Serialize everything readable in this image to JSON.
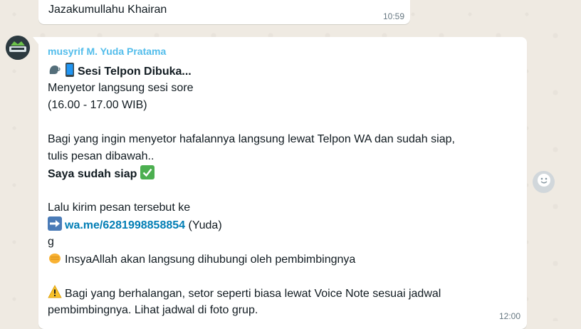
{
  "prev_message": {
    "text": "Jazakumullahu Khairan",
    "time": "10:59"
  },
  "message": {
    "sender": "musyrif M. Yuda Pratama",
    "title": "Sesi Telpon Dibuka...",
    "line1": "Menyetor langsung sesi sore",
    "line2": "(16.00 - 17.00 WIB)",
    "line3": "Bagi yang ingin menyetor hafalannya langsung lewat Telpon WA dan sudah siap,",
    "line4": "tulis pesan dibawah..",
    "ready": "Saya sudah siap",
    "line5": "Lalu kirim pesan tersebut ke",
    "link": "wa.me/6281998858854",
    "link_suffix": "(Yuda)",
    "line6": "g",
    "line7": "InsyaAllah akan langsung dihubungi oleh pembimbingnya",
    "line8": "Bagi yang berhalangan, setor seperti biasa lewat Voice Note sesuai jadwal",
    "line9": "pembimbingnya. Lihat jadwal di foto grup.",
    "time": "12:00"
  },
  "colors": {
    "sender": "#53bdeb",
    "link": "#027eb5",
    "check": "#4caf50"
  },
  "icons": [
    "speaking-head-icon",
    "mobile-phone-icon",
    "check-mark-icon",
    "right-arrow-icon",
    "fist-icon",
    "warning-icon",
    "emoji-react-icon"
  ]
}
